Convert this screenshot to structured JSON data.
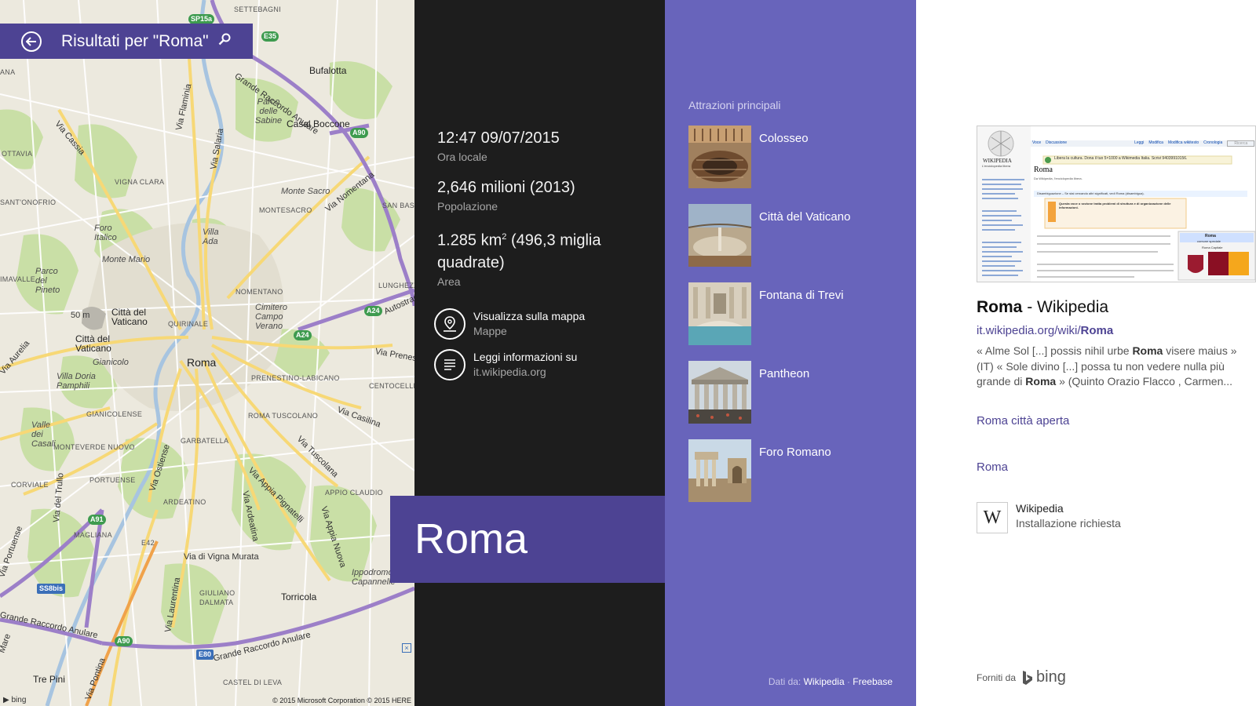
{
  "search": {
    "title": "Risultati per \"Roma\""
  },
  "map": {
    "labels": {
      "settebagni": "SETTEBAGNI",
      "bufalotta": "Bufalotta",
      "gra_top": "Grande Raccordo Anulare",
      "parco_sabine": "Parco delle Sabine",
      "casal_boccone": "Casal Boccone",
      "via_flaminia": "Via Flaminia",
      "via_cassia": "Via Cassia",
      "via_salaria": "Via Salaria",
      "ana": "ANA",
      "ottavia": "OTTAVIA",
      "vigna_clara": "VIGNA CLARA",
      "monte_sacro": "Monte Sacro",
      "montesacro": "MONTESACRO",
      "via_nomentana": "Via Nomentana",
      "sant_onofrio": "SANT'ONOFRIO",
      "san_basilio": "SAN BASILIO",
      "foro_italico": "Foro Italico",
      "villa_ada": "Villa Ada",
      "monte_mario": "Monte Mario",
      "imavalle": "IMAVALLE",
      "parco_pineto": "Parco del Pineto",
      "nomentano": "NOMENTANO",
      "lunghezza": "LUNGHEZZA",
      "autostrada": "Autostrad",
      "citta_vaticano_1": "Città del Vaticano",
      "quirinale": "QUIRINALE",
      "cimitero": "Cimitero Campo Verano",
      "citta_vaticano_2": "Città del Vaticano",
      "height": "50 m",
      "via_aurelia": "Via Aurelia",
      "gianicolo": "Gianicolo",
      "roma": "Roma",
      "via_prenestina": "Via Prenes",
      "villa_doria": "Villa Doria Pamphili",
      "prenestino": "PRENESTINO-LABICANO",
      "centocelle": "CENTOCELLE",
      "gianicolense": "GIANICOLENSE",
      "via_casilina": "Via Casilina",
      "roma_tuscolano": "ROMA TUSCOLANO",
      "valle_casali": "Valle dei Casali",
      "garbatella": "GARBATELLA",
      "via_tuscolana": "Via Tuscolana",
      "monteverde": "MONTEVERDE NUOVO",
      "via_appia_pign": "Via Appia Pignatelli",
      "corviale": "CORVIALE",
      "portuense": "PORTUENSE",
      "via_ostiense": "Via Ostiense",
      "appio_claudio": "APPIO CLAUDIO",
      "via_del_trullo": "Via del Trullo",
      "ardeatino": "ARDEATINO",
      "via_ardeatina": "Via Ardeatina",
      "via_appia_nuova": "Via Appia Nuova",
      "magliana": "MAGLIANA",
      "e42": "E42",
      "via_vigna_murata": "Via di Vigna Murata",
      "ippodromo": "Ippodromo Capannelle",
      "giuliano": "GIULIANO DALMATA",
      "torricola": "Torricola",
      "via_laurentina": "Via Laurentina",
      "via_fiumicino": "Via Portuense",
      "gra_bottom_left": "Grande Raccordo Anulare",
      "gra_bottom_right": "Grande Raccordo Anulare",
      "tre_pini": "Tre Pini",
      "castel_leva": "CASTEL DI LEVA",
      "via_pontina": "Via Pontina",
      "mare": "Mare"
    },
    "shields": {
      "sp15a": "SP15a",
      "e35": "E35",
      "a90_top": "A90",
      "a24_1": "A24",
      "a24_2": "A24",
      "a91": "A91",
      "a90_bottom": "A90",
      "e80": "E80",
      "ss8bis": "SS8bis"
    },
    "bing": "bing",
    "copyright": "© 2015 Microsoft Corporation © 2015 HERE"
  },
  "facts": [
    {
      "value": "12:47 09/07/2015",
      "label": "Ora locale"
    },
    {
      "value": "2,646 milioni (2013)",
      "label": "Popolazione"
    },
    {
      "value_main": "1.285 km",
      "value_sup": "2",
      "value_rest": " (496,3 miglia quadrate)",
      "label": "Area"
    }
  ],
  "actions": [
    {
      "title": "Visualizza sulla mappa",
      "sub": "Mappe"
    },
    {
      "title": "Leggi informazioni su",
      "sub": "it.wikipedia.org"
    }
  ],
  "city": "Roma",
  "attractions": {
    "header": "Attrazioni principali",
    "items": [
      "Colosseo",
      "Città del Vaticano",
      "Fontana di Trevi",
      "Pantheon",
      "Foro Romano"
    ],
    "source_prefix": "Dati da:",
    "source_wiki": "Wikipedia",
    "source_sep": " · ",
    "source_freebase": "Freebase"
  },
  "wiki": {
    "title_bold": "Roma",
    "title_rest": " - Wikipedia",
    "url_prefix": "it.wikipedia.org/wiki/",
    "url_bold": "Roma",
    "snippet_1": "« Alme Sol [...] possis nihil urbe ",
    "snippet_b1": "Roma",
    "snippet_2": " visere maius » (IT) « Sole divino [...] possa tu non vedere nulla più grande di ",
    "snippet_b2": "Roma",
    "snippet_3": " » (Quinto Orazio Flacco , Carmen...",
    "link_1": "Roma città aperta",
    "link_2": "Roma",
    "app_icon": "W",
    "app_name": "Wikipedia",
    "app_sub": "Installazione richiesta",
    "powered_by": "Forniti da",
    "bing": "bing",
    "shot": {
      "logo_title": "WIKIPEDIA",
      "logo_sub": "L'enciclopedia libera",
      "tab_voce": "Voce",
      "tab_discussione": "Discussione",
      "tab_leggi": "Leggi",
      "tab_modifica": "Modifica",
      "tab_wikitesto": "Modifica wikitesto",
      "tab_cronologia": "Cronologia",
      "search_ph": "Ricerca",
      "banner": "Libera la cultura. Dona il tuo 5×1000 a Wikimedia Italia. Scrivi 94039910156.",
      "page_title": "Roma",
      "from": "Da Wikipedia, l'enciclopedia libera.",
      "notice": "Disambiguazione – Se stai cercando altri significati, vedi Roma (disambigua).",
      "box_title": "Questa voce o sezione tratta problemi di struttura e di organizzazione delle informazioni.",
      "infobox_title": "Roma",
      "infobox_sub": "comune speciale",
      "infobox_caption": "Roma Capitale",
      "sidebar_links": [
        "Pagina principale",
        "Ultime modifiche",
        "Una voce a caso",
        "Vetrina",
        "Aiuto",
        "Comunità",
        "Portale Comunità",
        "Bar",
        "Il Wikipediano",
        "Fai una donazione",
        "Contatti",
        "Strumenti",
        "Puntano qui",
        "Modifiche correlate",
        "Carica su Commons",
        "Pagine speciali",
        "Link permanente",
        "Informazioni sulla pagina",
        "Elemento Wikidata",
        "Cita questa voce"
      ]
    }
  },
  "colors": {
    "accent": "#4d4393",
    "attractions_bg": "#6864bb",
    "info_bg": "#1d1d1d",
    "link": "#4d4393"
  }
}
